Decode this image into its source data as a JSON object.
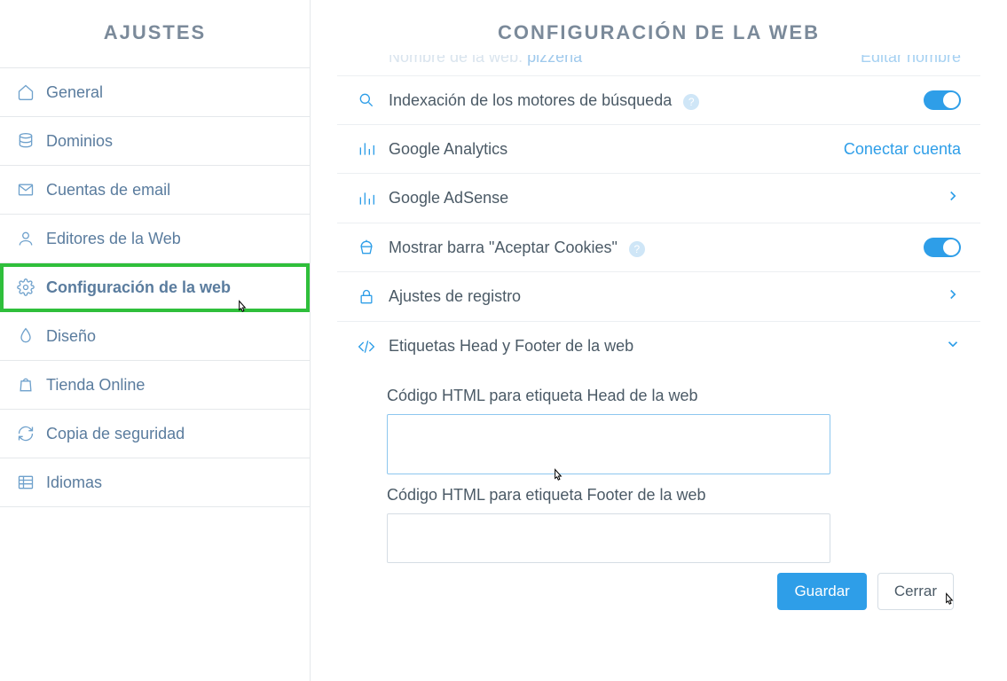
{
  "sidebar": {
    "title": "AJUSTES",
    "items": [
      {
        "label": "General"
      },
      {
        "label": "Dominios"
      },
      {
        "label": "Cuentas de email"
      },
      {
        "label": "Editores de la Web"
      },
      {
        "label": "Configuración de la web"
      },
      {
        "label": "Diseño"
      },
      {
        "label": "Tienda Online"
      },
      {
        "label": "Copia de seguridad"
      },
      {
        "label": "Idiomas"
      }
    ]
  },
  "main": {
    "title": "CONFIGURACIÓN DE LA WEB",
    "partial": {
      "label_prefix": "Nombre de la web: ",
      "label_value": "pizzeria",
      "action": "Editar nombre"
    },
    "rows": {
      "indexing": {
        "label": "Indexación de los motores de búsqueda"
      },
      "analytics": {
        "label": "Google Analytics",
        "action": "Conectar cuenta"
      },
      "adsense": {
        "label": "Google AdSense"
      },
      "cookies": {
        "label": "Mostrar barra \"Aceptar Cookies\""
      },
      "register": {
        "label": "Ajustes de registro"
      },
      "headfooter": {
        "label": "Etiquetas Head y Footer de la web",
        "head_field": "Código HTML para etiqueta Head de la web",
        "footer_field": "Código HTML para etiqueta Footer de la web"
      }
    }
  },
  "actions": {
    "save": "Guardar",
    "close": "Cerrar"
  }
}
